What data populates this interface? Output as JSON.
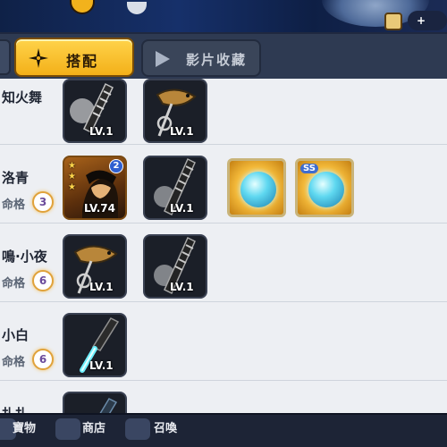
{
  "tabs": [
    {
      "label": "搭配",
      "icon": "shuriken-icon",
      "active": true
    },
    {
      "label": "影片收藏",
      "icon": "play-icon",
      "active": false
    }
  ],
  "lineup": [
    {
      "name": "知火舞",
      "fate_label": "",
      "fate_level": "",
      "items": [
        {
          "kind": "weapon",
          "icon": "wrapped-blade-icon",
          "level": "LV.1"
        },
        {
          "kind": "weapon",
          "icon": "fish-kunai-icon",
          "level": "LV.1"
        }
      ]
    },
    {
      "name": "洛青",
      "fate_label": "命格",
      "fate_level": "3",
      "items": [
        {
          "kind": "ninja",
          "icon": "ninja-portrait-icon",
          "level": "LV.74",
          "badge": "2"
        },
        {
          "kind": "weapon",
          "icon": "wrapped-blade-icon",
          "level": "LV.1"
        },
        {
          "kind": "mystic",
          "icon": "spirit-orb-icon",
          "grade": ""
        },
        {
          "kind": "mystic",
          "icon": "spirit-orb-icon",
          "grade": "SS"
        }
      ]
    },
    {
      "name": "鳴·小夜",
      "fate_label": "命格",
      "fate_level": "6",
      "items": [
        {
          "kind": "weapon",
          "icon": "fish-kunai-icon",
          "level": "LV.1"
        },
        {
          "kind": "weapon",
          "icon": "wrapped-blade-icon",
          "level": "LV.1"
        }
      ]
    },
    {
      "name": "小白",
      "fate_label": "命格",
      "fate_level": "6",
      "items": [
        {
          "kind": "weapon",
          "icon": "glowing-blade-icon",
          "level": "LV.1"
        }
      ]
    },
    {
      "name": "扎扎",
      "fate_label": "",
      "fate_level": "",
      "items": []
    }
  ],
  "bottom_nav": [
    "寶物",
    "商店",
    "召喚"
  ],
  "colors": {
    "tab_active": "#f3b019",
    "panel_bg": "#edeff3",
    "top_bar": "#0f2147"
  }
}
